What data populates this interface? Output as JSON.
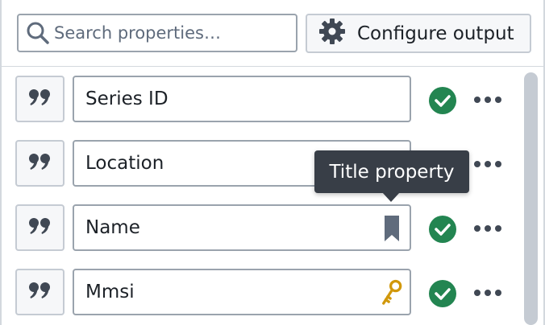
{
  "toolbar": {
    "search": {
      "placeholder": "Search properties…",
      "value": "",
      "icon": "search-icon"
    },
    "configure_button": {
      "label": "Configure output",
      "icon": "gear-icon"
    }
  },
  "properties": [
    {
      "name": "Series ID",
      "type_icon": "quote-icon",
      "field_icon": null,
      "status": "valid",
      "status_icon": "check-circle-icon"
    },
    {
      "name": "Location",
      "type_icon": "quote-icon",
      "field_icon": null,
      "status": "valid",
      "status_icon": "check-circle-icon"
    },
    {
      "name": "Name",
      "type_icon": "quote-icon",
      "field_icon": "bookmark-icon",
      "status": "valid",
      "status_icon": "check-circle-icon"
    },
    {
      "name": "Mmsi",
      "type_icon": "quote-icon",
      "field_icon": "key-icon",
      "status": "valid",
      "status_icon": "check-circle-icon"
    }
  ],
  "tooltip": {
    "text": "Title property"
  },
  "colors": {
    "success": "#238551",
    "key": "#d1980b",
    "bookmark": "#5f6b7c",
    "tooltip_bg": "#383e47"
  }
}
